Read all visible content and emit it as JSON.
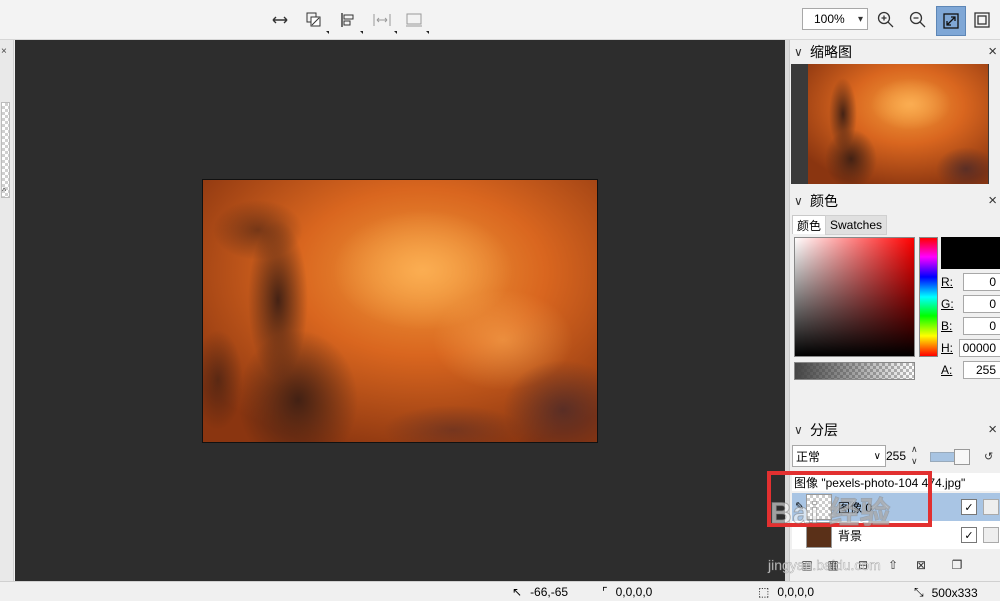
{
  "toolbar": {
    "zoom_value": "100%"
  },
  "panels": {
    "thumbnail": {
      "title": "缩略图"
    },
    "color": {
      "title": "颜色",
      "tabs": [
        "颜色",
        "Swatches"
      ],
      "channels": [
        {
          "label": "R:",
          "value": "0"
        },
        {
          "label": "G:",
          "value": "0"
        },
        {
          "label": "B:",
          "value": "0"
        },
        {
          "label": "H:",
          "value": "00000"
        },
        {
          "label": "A:",
          "value": "255"
        }
      ],
      "current_color": "#000000"
    },
    "layers": {
      "title": "分层",
      "blend_mode": "正常",
      "opacity": "255",
      "image_name": "图像 \"pexels-photo-104 474.jpg\"",
      "items": [
        {
          "name": "图像 0",
          "visible": true,
          "selected": true
        },
        {
          "name": "背景",
          "visible": true,
          "selected": false
        }
      ]
    }
  },
  "statusbar": {
    "cursor_pos": "-66,-65",
    "selection_size": "0,0,0,0",
    "selection_offset": "0,0,0,0",
    "image_size": "500x333"
  },
  "watermark": {
    "brand": "Bai 经验",
    "url": "jingyan.baidu.com"
  },
  "colors": {
    "canvas_bg": "#2d2d2d",
    "selected_layer": "#a9c5e4",
    "highlight_box": "#e23030",
    "sky_orange": "#c4561a"
  }
}
